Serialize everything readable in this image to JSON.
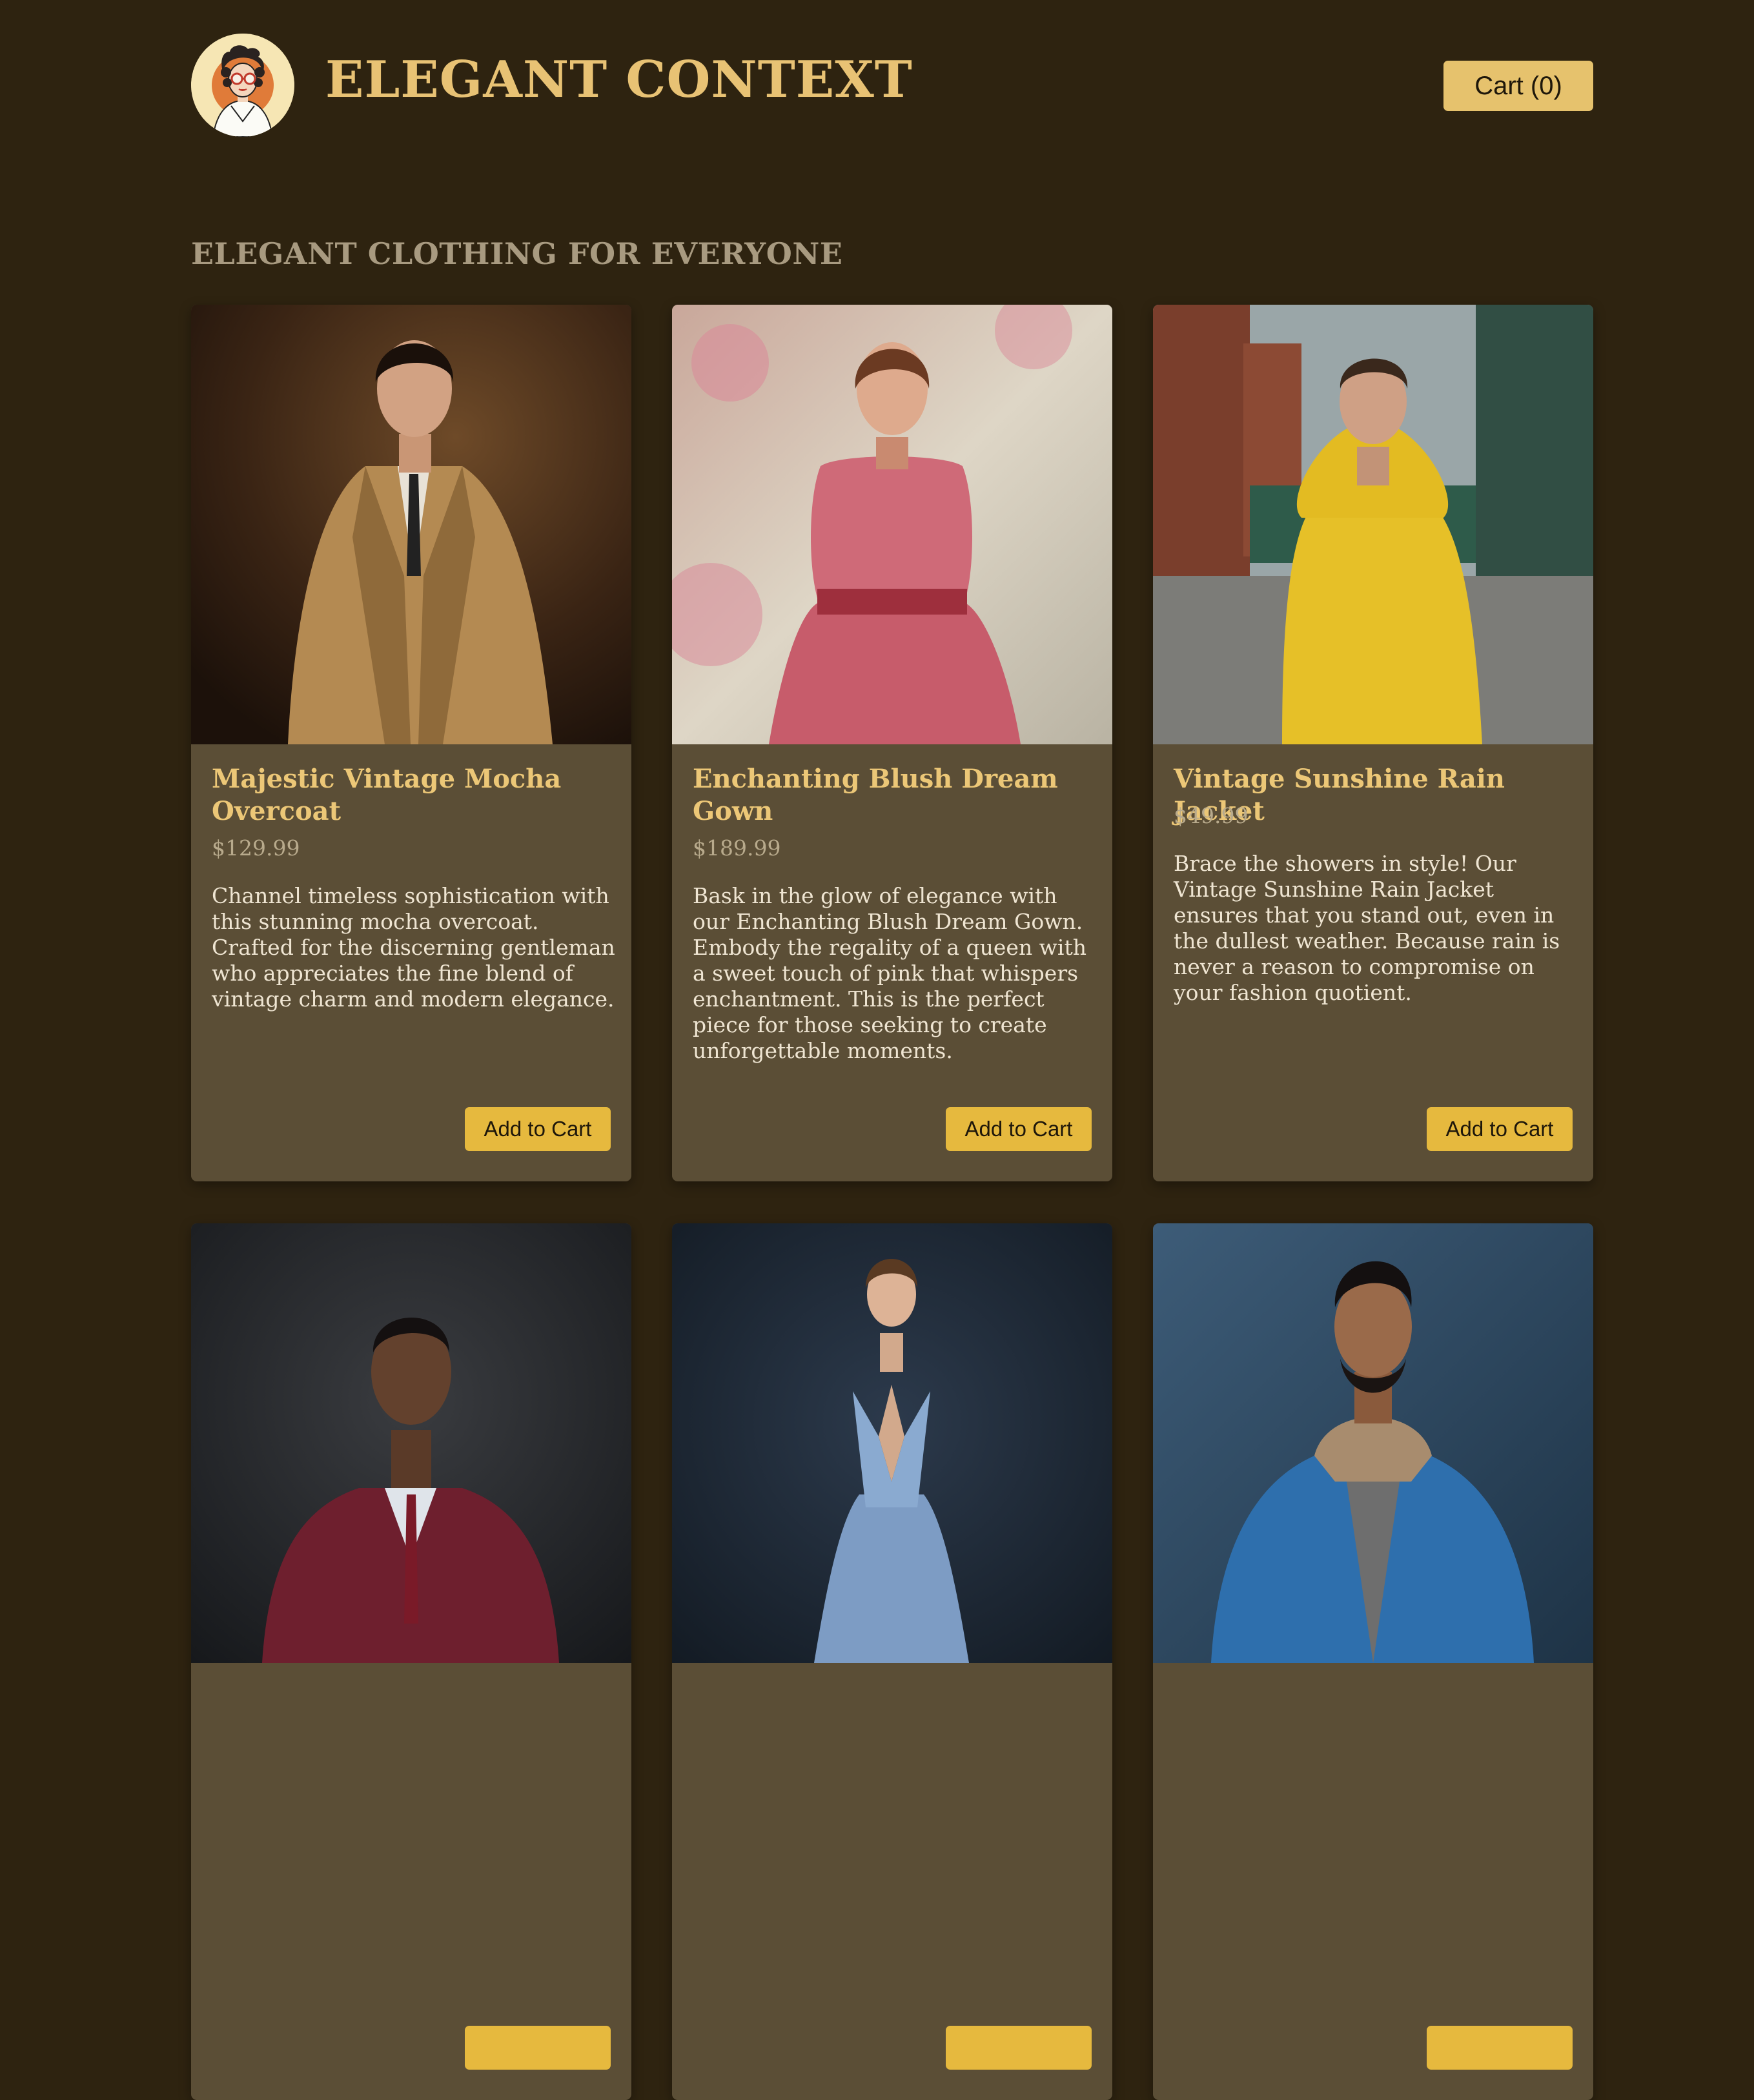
{
  "header": {
    "site_title": "ELEGANT CONTEXT",
    "cart_label": "Cart (0)"
  },
  "section_title": "ELEGANT CLOTHING FOR EVERYONE",
  "colors": {
    "background": "#2e2310",
    "card": "#5b4e36",
    "accent": "#e6c26d",
    "title": "#e8c274"
  },
  "products": [
    {
      "name": "Majestic Vintage Mocha Overcoat",
      "price": "$129.99",
      "description": "Channel timeless sophistication with this stunning mocha overcoat. Crafted for the discerning gentleman who appreciates the fine blend of vintage charm and modern elegance.",
      "button": "Add to Cart"
    },
    {
      "name": "Enchanting Blush Dream Gown",
      "price": "$189.99",
      "description": "Bask in the glow of elegance with our Enchanting Blush Dream Gown. Embody the regality of a queen with a sweet touch of pink that whispers enchantment. This is the perfect piece for those seeking to create unforgettable moments.",
      "button": "Add to Cart"
    },
    {
      "name": "Vintage Sunshine Rain Jacket",
      "price": "$49.99",
      "description": "Brace the showers in style! Our Vintage Sunshine Rain Jacket ensures that you stand out, even in the dullest weather. Because rain is never a reason to compromise on your fashion quotient.",
      "button": "Add to Cart"
    },
    {
      "name": "",
      "price": "",
      "description": "",
      "button": ""
    },
    {
      "name": "",
      "price": "",
      "description": "",
      "button": ""
    },
    {
      "name": "",
      "price": "",
      "description": "",
      "button": ""
    }
  ]
}
